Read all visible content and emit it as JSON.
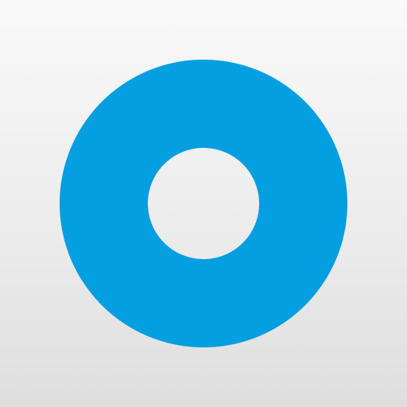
{
  "icon": {
    "name": "ring-icon",
    "shape": "donut",
    "ring_color": "#039fe0"
  },
  "background": {
    "gradient_top": "#f9f9f9",
    "gradient_bottom": "#dedede"
  }
}
